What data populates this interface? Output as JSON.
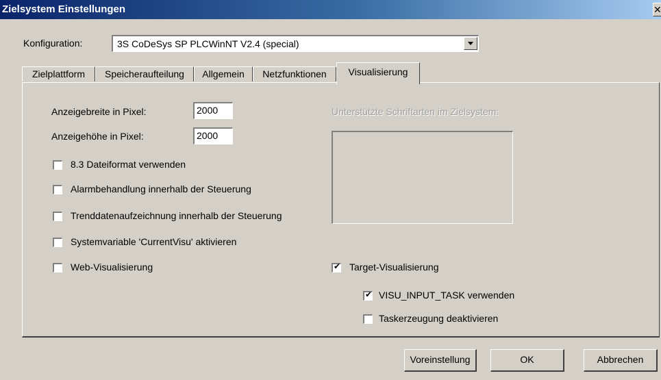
{
  "window": {
    "title": "Zielsystem Einstellungen",
    "close_glyph": "✕"
  },
  "config": {
    "label": "Konfiguration:",
    "value": "3S CoDeSys SP PLCWinNT V2.4 (special)"
  },
  "tabs": [
    {
      "label": "Zielplattform"
    },
    {
      "label": "Speicheraufteilung"
    },
    {
      "label": "Allgemein"
    },
    {
      "label": "Netzfunktionen"
    },
    {
      "label": "Visualisierung",
      "active": true
    }
  ],
  "visualisierung": {
    "display_width_label": "Anzeigebreite in Pixel:",
    "display_width_value": "2000",
    "display_height_label": "Anzeigehöhe in Pixel:",
    "display_height_value": "2000",
    "options": [
      {
        "label": "8.3 Dateiformat verwenden",
        "checked": false
      },
      {
        "label": "Alarmbehandlung innerhalb der Steuerung",
        "checked": false
      },
      {
        "label": "Trenddatenaufzeichnung innerhalb der Steuerung",
        "checked": false
      },
      {
        "label": "Systemvariable 'CurrentVisu' aktivieren",
        "checked": false
      },
      {
        "label": "Web-Visualisierung",
        "checked": false
      }
    ],
    "fonts_label": "Unterstützte Schriftarten im Zielsystem:",
    "target_visu": {
      "label": "Target-Visualisierung",
      "checked": true
    },
    "visu_input_task": {
      "label": "VISU_INPUT_TASK verwenden",
      "checked": true
    },
    "task_disable": {
      "label": "Taskerzeugung deaktivieren",
      "checked": false
    }
  },
  "buttons": {
    "defaults": "Voreinstellung",
    "ok": "OK",
    "cancel": "Abbrechen"
  },
  "colors": {
    "titlebar_start": "#0a246a",
    "titlebar_end": "#a6caf0",
    "face": "#d4d0c8"
  }
}
